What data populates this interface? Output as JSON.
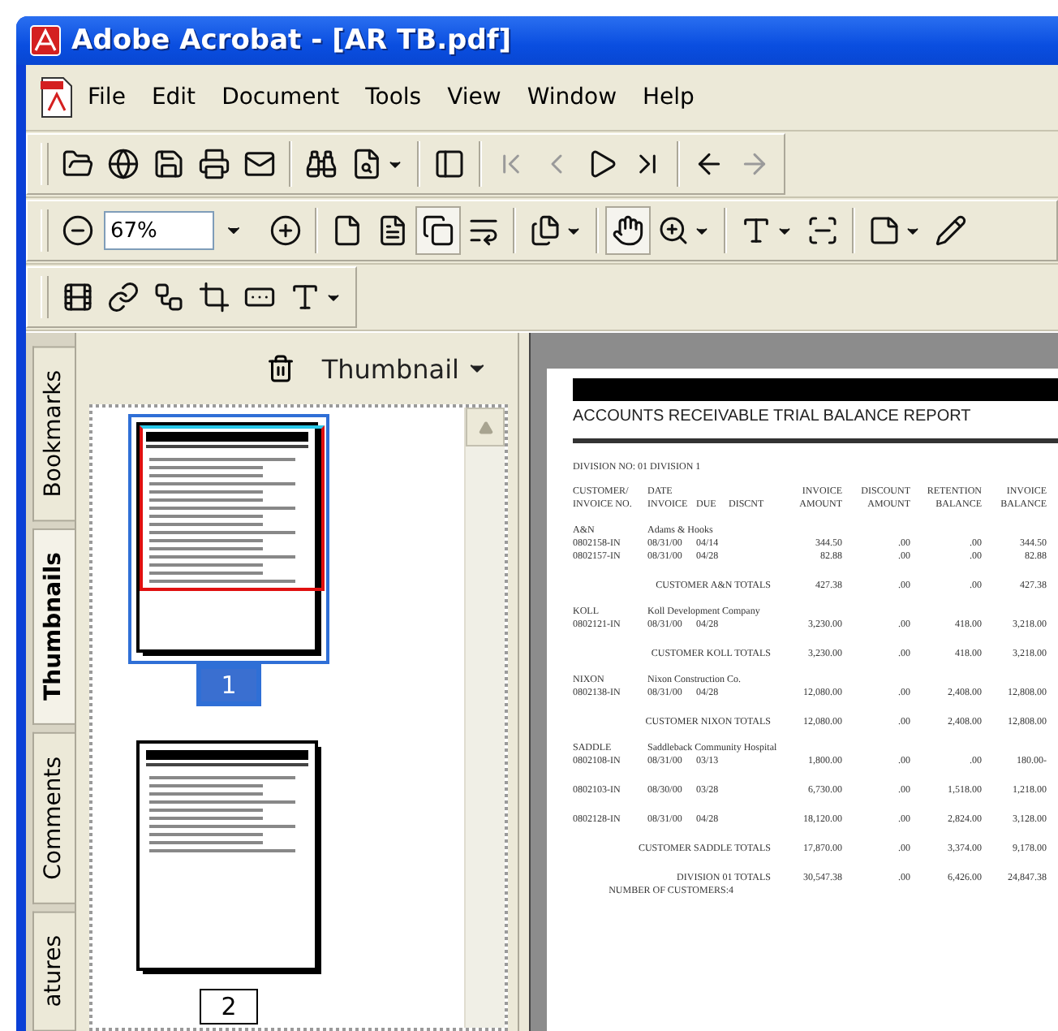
{
  "window": {
    "title": "Adobe Acrobat - [AR TB.pdf]"
  },
  "menu": [
    "File",
    "Edit",
    "Document",
    "Tools",
    "View",
    "Window",
    "Help"
  ],
  "toolbars": [
    {
      "buttons": [
        {
          "pressed": false,
          "disabled": false
        },
        {
          "pressed": false,
          "disabled": false
        },
        {
          "pressed": false,
          "disabled": false
        },
        {
          "pressed": false,
          "disabled": false
        },
        {
          "pressed": false,
          "disabled": false
        },
        {
          "pressed": false,
          "disabled": false
        },
        {
          "pressed": false,
          "disabled": false
        },
        {
          "pressed": false,
          "disabled": false
        },
        {
          "pressed": false,
          "disabled": true
        },
        {
          "pressed": false,
          "disabled": true
        },
        {
          "pressed": false,
          "disabled": false
        },
        {
          "pressed": false,
          "disabled": false
        },
        {
          "pressed": false,
          "disabled": false
        },
        {
          "pressed": false,
          "disabled": true
        }
      ]
    },
    {
      "buttons": [
        {
          "pressed": false,
          "disabled": false
        },
        {
          "pressed": false,
          "disabled": false
        },
        {
          "pressed": false,
          "disabled": false
        },
        {
          "pressed": false,
          "disabled": false
        },
        {
          "pressed": false,
          "disabled": false
        },
        {
          "pressed": true,
          "disabled": false
        },
        {
          "pressed": false,
          "disabled": false
        },
        {
          "pressed": false,
          "disabled": false
        },
        {
          "pressed": true,
          "disabled": false
        },
        {
          "pressed": false,
          "disabled": false
        },
        {
          "pressed": false,
          "disabled": false
        },
        {
          "pressed": false,
          "disabled": false
        },
        {
          "pressed": false,
          "disabled": false
        },
        {
          "pressed": false,
          "disabled": false
        }
      ]
    },
    {
      "buttons": [
        {
          "pressed": false,
          "disabled": false
        },
        {
          "pressed": false,
          "disabled": false
        },
        {
          "pressed": false,
          "disabled": false
        },
        {
          "pressed": false,
          "disabled": false
        },
        {
          "pressed": false,
          "disabled": false
        },
        {
          "pressed": false,
          "disabled": false
        }
      ]
    }
  ],
  "zoom_field": {
    "value": "67%"
  },
  "tabs": [
    {
      "label": "Bookmarks",
      "selected": false
    },
    {
      "label": "Thumbnails",
      "selected": true
    },
    {
      "label": "Comments",
      "selected": false
    },
    {
      "label": "atures",
      "selected": false
    }
  ],
  "navigation_pane": {
    "options_label": "Thumbnail",
    "thumbnails": [
      {
        "page": "1",
        "selected": true
      },
      {
        "page": "2",
        "selected": false
      }
    ]
  },
  "report": {
    "title": "ACCOUNTS RECEIVABLE TRIAL BALANCE REPORT",
    "division": "DIVISION NO: 01 DIVISION 1",
    "header_top": [
      "CUSTOMER/",
      "DATE",
      "INVOICE",
      "DISCOUNT",
      "RETENTION",
      "INVOICE"
    ],
    "header_bottom": [
      "INVOICE NO.",
      "INVOICE",
      "DUE",
      "DISCNT",
      "AMOUNT",
      "AMOUNT",
      "BALANCE",
      "BALANCE"
    ],
    "rows": [
      {
        "kind": "customer",
        "code": "A&N",
        "name": "Adams & Hooks"
      },
      {
        "kind": "invoice",
        "invoice_no": "0802158-IN",
        "date": "08/31/00",
        "due": "04/14",
        "amount": "344.50",
        "discount": ".00",
        "retention": ".00",
        "balance": "344.50"
      },
      {
        "kind": "invoice",
        "invoice_no": "0802157-IN",
        "date": "08/31/00",
        "due": "04/28",
        "amount": "82.88",
        "discount": ".00",
        "retention": ".00",
        "balance": "82.88"
      },
      {
        "kind": "total",
        "label": "CUSTOMER A&N TOTALS",
        "amount": "427.38",
        "discount": ".00",
        "retention": ".00",
        "balance": "427.38"
      },
      {
        "kind": "customer",
        "code": "KOLL",
        "name": "Koll Development Company"
      },
      {
        "kind": "invoice",
        "invoice_no": "0802121-IN",
        "date": "08/31/00",
        "due": "04/28",
        "amount": "3,230.00",
        "discount": ".00",
        "retention": "418.00",
        "balance": "3,218.00"
      },
      {
        "kind": "total",
        "label": "CUSTOMER KOLL TOTALS",
        "amount": "3,230.00",
        "discount": ".00",
        "retention": "418.00",
        "balance": "3,218.00"
      },
      {
        "kind": "customer",
        "code": "NIXON",
        "name": "Nixon Construction Co."
      },
      {
        "kind": "invoice",
        "invoice_no": "0802138-IN",
        "date": "08/31/00",
        "due": "04/28",
        "amount": "12,080.00",
        "discount": ".00",
        "retention": "2,408.00",
        "balance": "12,808.00"
      },
      {
        "kind": "total",
        "label": "CUSTOMER NIXON TOTALS",
        "amount": "12,080.00",
        "discount": ".00",
        "retention": "2,408.00",
        "balance": "12,808.00"
      },
      {
        "kind": "customer",
        "code": "SADDLE",
        "name": "Saddleback Community Hospital"
      },
      {
        "kind": "invoice",
        "invoice_no": "0802108-IN",
        "date": "08/31/00",
        "due": "03/13",
        "amount": "1,800.00",
        "discount": ".00",
        "retention": ".00",
        "balance": "180.00-"
      },
      {
        "kind": "invoice",
        "invoice_no": "0802103-IN",
        "date": "08/30/00",
        "due": "03/28",
        "amount": "6,730.00",
        "discount": ".00",
        "retention": "1,518.00",
        "balance": "1,218.00"
      },
      {
        "kind": "invoice",
        "invoice_no": "0802128-IN",
        "date": "08/31/00",
        "due": "04/28",
        "amount": "18,120.00",
        "discount": ".00",
        "retention": "2,824.00",
        "balance": "3,128.00"
      },
      {
        "kind": "total",
        "label": "CUSTOMER SADDLE TOTALS",
        "amount": "17,870.00",
        "discount": ".00",
        "retention": "3,374.00",
        "balance": "9,178.00"
      },
      {
        "kind": "total",
        "label": "DIVISION 01 TOTALS",
        "amount": "30,547.38",
        "discount": ".00",
        "retention": "6,426.00",
        "balance": "24,847.38"
      },
      {
        "kind": "count",
        "label": "NUMBER OF CUSTOMERS:",
        "value": "4"
      }
    ]
  }
}
